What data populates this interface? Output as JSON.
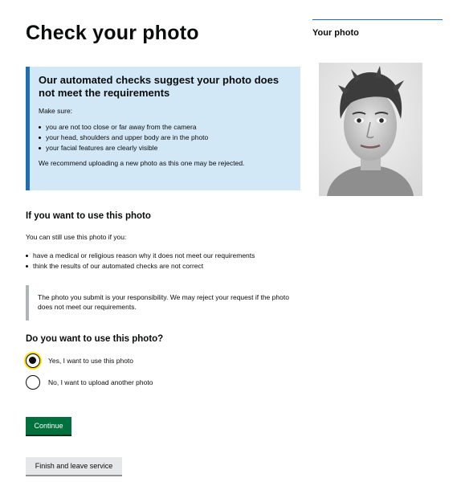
{
  "page": {
    "title": "Check your photo"
  },
  "warning": {
    "title": "Our automated checks suggest your photo does not meet the requirements",
    "make_sure": "Make sure:",
    "items": [
      "you are not too close or far away from the camera",
      "your head, shoulders and upper body are in the photo",
      "your facial features are clearly visible"
    ],
    "recommendation": "We recommend uploading a new photo as this one may be rejected."
  },
  "use_photo": {
    "heading": "If you want to use this photo",
    "intro": "You can still use this photo if you:",
    "items": [
      "have a medical or religious reason why it does not meet our requirements",
      "think the results of our automated checks are not correct"
    ],
    "inset": "The photo you submit is your responsibility. We may reject your request if the photo does not meet our requirements."
  },
  "question": {
    "heading": "Do you want to use this photo?",
    "options": [
      {
        "label": "Yes, I want to use this photo",
        "checked": true
      },
      {
        "label": "No, I want to upload another photo",
        "checked": false
      }
    ]
  },
  "buttons": {
    "continue": "Continue",
    "finish": "Finish and leave service"
  },
  "sidebar": {
    "title": "Your photo"
  },
  "colors": {
    "warning_bg": "#d2e8f6",
    "warning_border": "#1d70b8",
    "primary_button": "#00703c",
    "focus": "#ffdd00"
  }
}
